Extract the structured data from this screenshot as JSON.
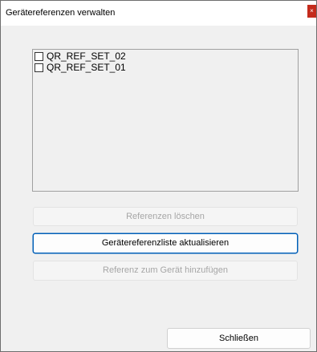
{
  "window": {
    "title": "Gerätereferenzen verwalten",
    "close_glyph": "×"
  },
  "references": {
    "items": [
      {
        "label": "QR_REF_SET_02",
        "checked": false
      },
      {
        "label": "QR_REF_SET_01",
        "checked": false
      }
    ]
  },
  "buttons": {
    "delete_label": "Referenzen löschen",
    "delete_enabled": false,
    "refresh_label": "Gerätereferenzliste aktualisieren",
    "refresh_enabled": true,
    "add_label": "Referenz zum Gerät hinzufügen",
    "add_enabled": false,
    "close_label": "Schließen",
    "close_enabled": true
  }
}
